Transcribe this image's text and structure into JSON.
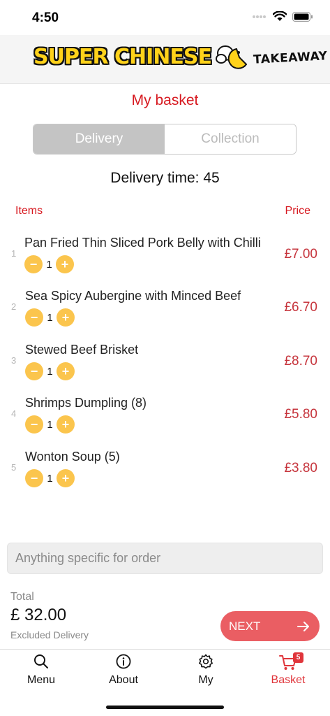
{
  "status": {
    "time": "4:50"
  },
  "header": {
    "logo_main": "SUPER CHINESE",
    "logo_sub": "TAKEAWAY"
  },
  "page_title": "My basket",
  "tabs": {
    "delivery": "Delivery",
    "collection": "Collection",
    "selected": "Delivery"
  },
  "delivery_time": "Delivery time: 45",
  "columns": {
    "items": "Items",
    "price": "Price"
  },
  "items": [
    {
      "num": "1",
      "name": "Pan Fried Thin Sliced Pork Belly with Chilli",
      "qty": "1",
      "price": "£7.00"
    },
    {
      "num": "2",
      "name": "Sea Spicy Aubergine with Minced Beef",
      "qty": "1",
      "price": "£6.70"
    },
    {
      "num": "3",
      "name": "Stewed Beef Brisket",
      "qty": "1",
      "price": "£8.70"
    },
    {
      "num": "4",
      "name": "Shrimps Dumpling (8)",
      "qty": "1",
      "price": "£5.80"
    },
    {
      "num": "5",
      "name": "Wonton Soup (5)",
      "qty": "1",
      "price": "£3.80"
    }
  ],
  "note": {
    "placeholder": "Anything specific for order",
    "value": ""
  },
  "total": {
    "label": "Total",
    "value": "£ 32.00",
    "note": "Excluded Delivery"
  },
  "next_button": "NEXT",
  "nav": {
    "menu": "Menu",
    "about": "About",
    "my": "My",
    "basket": "Basket",
    "basket_badge": "5",
    "active": "Basket"
  },
  "colors": {
    "accent_red": "#d71920",
    "button_yellow": "#fbc54d",
    "next_button": "#ea5e63"
  }
}
